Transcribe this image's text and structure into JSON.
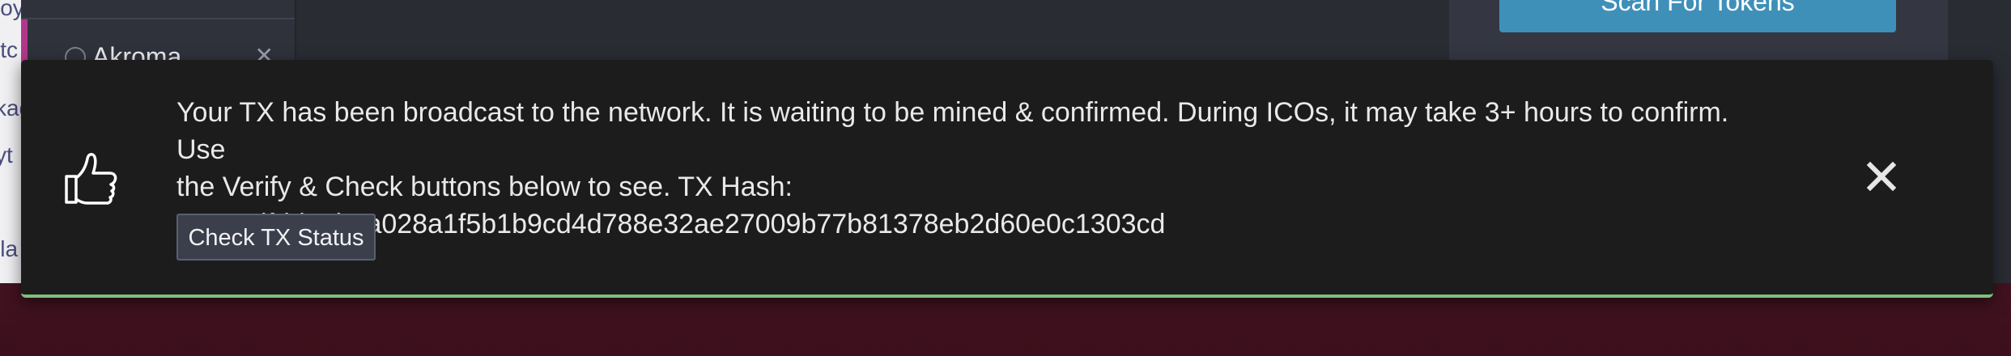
{
  "background": {
    "left_strip_text": [
      "ioy",
      "itc",
      "kag",
      "yt",
      "lla"
    ],
    "sidebar": {
      "selected_network": "Akroma"
    },
    "right_panel": {
      "scan_button_label": "Scan For Tokens"
    }
  },
  "notification": {
    "type": "success",
    "icon": "thumbs-up-icon",
    "message_lines": [
      "Your TX has been broadcast to the network. It is waiting to be mined & confirmed. During ICOs, it may take 3+ hours to confirm. Use",
      "the Verify & Check buttons below to see. TX Hash:",
      "0x356dfdd20b9a028a1f5b1b9cd4d788e32ae27009b77b81378eb2d60e0c1303cd"
    ],
    "check_button_label": "Check TX Status",
    "close_icon": "close-icon",
    "accent_color": "#7fc07a"
  }
}
